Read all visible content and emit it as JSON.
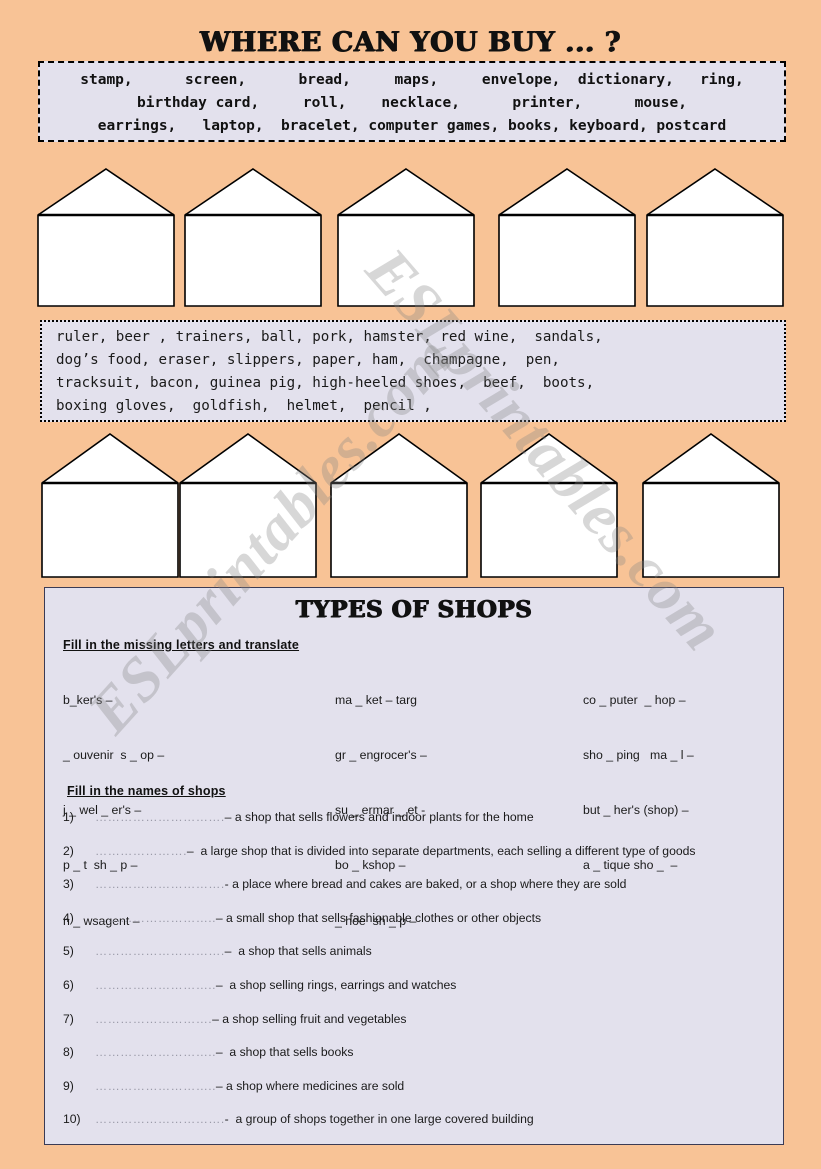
{
  "title": "WHERE CAN YOU BUY ... ?",
  "colors": {
    "page_background": "#f8c396",
    "box_fill": "#e3e1ed",
    "panel_border": "#3b3b55",
    "text": "#1a1a1a"
  },
  "wordbox_1": {
    "lines": [
      "stamp,      screen,      bread,     maps,     envelope,  dictionary,   ring,",
      "birthday card,     roll,    necklace,      printer,      mouse,",
      "earrings,   laptop,  bracelet, computer games, books, keyboard, postcard"
    ],
    "words": [
      "stamp",
      "screen",
      "bread",
      "maps",
      "envelope",
      "dictionary",
      "ring",
      "birthday card",
      "roll",
      "necklace",
      "printer",
      "mouse",
      "earrings",
      "laptop",
      "bracelet",
      "computer games",
      "books",
      "keyboard",
      "postcard"
    ]
  },
  "wordbox_2": {
    "lines": [
      "ruler, beer , trainers, ball, pork, hamster, red wine,  sandals,",
      "dog’s food, eraser, slippers, paper, ham,  champagne,  pen,",
      "tracksuit, bacon, guinea pig, high-heeled shoes,  beef,  boots,",
      "boxing gloves,  goldfish,  helmet,  pencil ,"
    ],
    "words": [
      "ruler",
      "beer",
      "trainers",
      "ball",
      "pork",
      "hamster",
      "red wine",
      "sandals",
      "dog’s food",
      "eraser",
      "slippers",
      "paper",
      "ham",
      "champagne",
      "pen",
      "tracksuit",
      "bacon",
      "guinea pig",
      "high-heeled shoes",
      "beef",
      "boots",
      "boxing gloves",
      "goldfish",
      "helmet",
      "pencil"
    ]
  },
  "houses_row_1": {
    "count": 5
  },
  "houses_row_2": {
    "count": 5
  },
  "panel": {
    "title": "TYPES OF SHOPS",
    "heading_letters": "Fill in the missing letters and translate",
    "heading_names": "Fill in the names of shops",
    "letters_columns": [
      {
        "items": [
          "b_ker's –",
          "_ ouvenir  s _ op –",
          "j _ wel _ er's –",
          "p _ t  sh _ p –",
          "n _ wsagent –"
        ]
      },
      {
        "items": [
          "ma _ ket – targ",
          "gr _ engrocer's –",
          "su _ ermar _ et -",
          "bo _ kshop –",
          "_ hoe  sh _ p –"
        ]
      },
      {
        "items": [
          "co _ puter  _ hop –",
          "sho _ ping   ma _ l –",
          "but _ her's (shop) –",
          "a _ tique sho _  –"
        ]
      }
    ],
    "names_rows": [
      {
        "num": "1)",
        "dots": "………………………….",
        "def": "– a shop that sells flowers and indoor plants for the home"
      },
      {
        "num": "2)",
        "dots": "………………….",
        "def": "–  a large shop that is divided into separate departments, each selling a different type of goods"
      },
      {
        "num": "3)",
        "dots": "………………………….",
        "def": "- a place where bread and cakes are baked, or a shop where they are sold"
      },
      {
        "num": "4)",
        "dots": "………………………..",
        "def": "– a small shop that sells fashionable clothes or other objects"
      },
      {
        "num": "5)",
        "dots": "………………………….",
        "def": "–  a shop that sells animals"
      },
      {
        "num": "6)",
        "dots": "………………………..",
        "def": "–  a shop selling rings, earrings and watches"
      },
      {
        "num": "7)",
        "dots": "……………………….",
        "def": "– a shop selling fruit and vegetables"
      },
      {
        "num": "8)",
        "dots": "………………………..",
        "def": "–  a shop that sells books"
      },
      {
        "num": "9)",
        "dots": "………………………..",
        "def": "– a shop where medicines are sold"
      },
      {
        "num": "10)",
        "dots": "………………………….",
        "def": "-  a group of shops together in one large covered building"
      }
    ]
  },
  "watermark": {
    "line_1": "ESLprintables.com",
    "line_2": "ESLprintables.com"
  }
}
